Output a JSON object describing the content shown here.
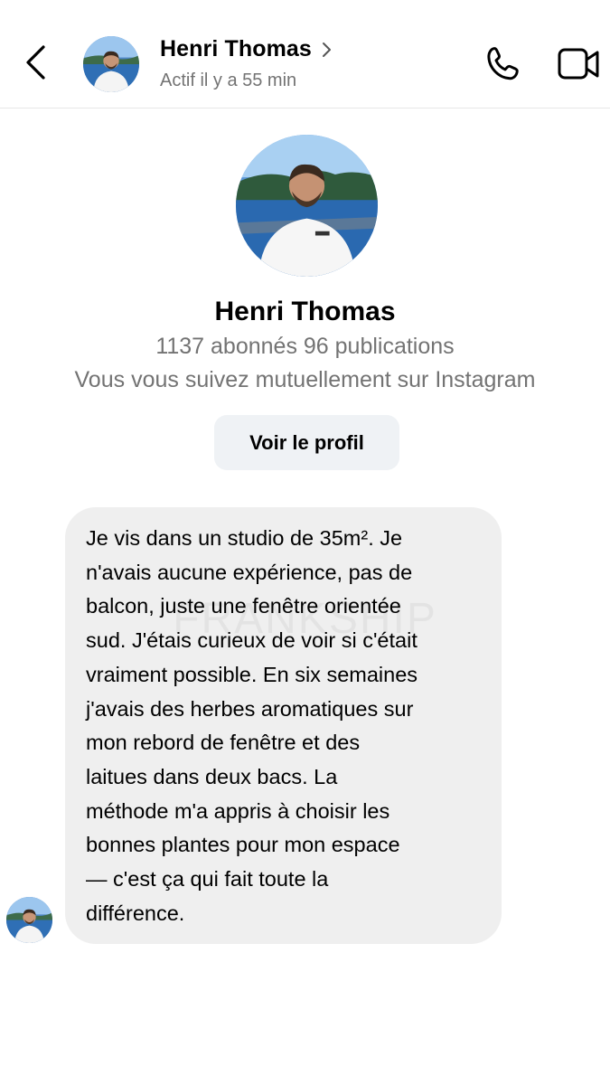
{
  "watermark": "FRANKSHIP",
  "header": {
    "contact_name": "Henri Thomas",
    "status": "Actif il y a 55 min",
    "back_icon": "chevron-left-icon",
    "call_icon": "phone-icon",
    "video_icon": "video-camera-icon"
  },
  "profile": {
    "name": "Henri Thomas",
    "stats": "1137 abonnés 96 publications",
    "mutual": "Vous vous suivez mutuellement sur Instagram",
    "view_profile_label": "Voir le profil"
  },
  "messages": [
    {
      "from": "contact",
      "text": "Je vis dans un studio de 35m². Je\nn'avais aucune expérience, pas de\nbalcon, juste une fenêtre orientée\nsud. J'étais curieux de voir si c'était\nvraiment possible. En six semaines\nj'avais des herbes aromatiques sur\nmon rebord de fenêtre et des\nlaitues dans deux bacs. La\nméthode m'a appris à choisir les\nbonnes plantes pour mon espace\n— c'est ça qui fait toute la\ndifférence."
    }
  ],
  "colors": {
    "muted_text": "#737373",
    "bubble_bg": "#efefef",
    "button_bg": "#eff2f5",
    "divider": "#e6e6e6"
  }
}
